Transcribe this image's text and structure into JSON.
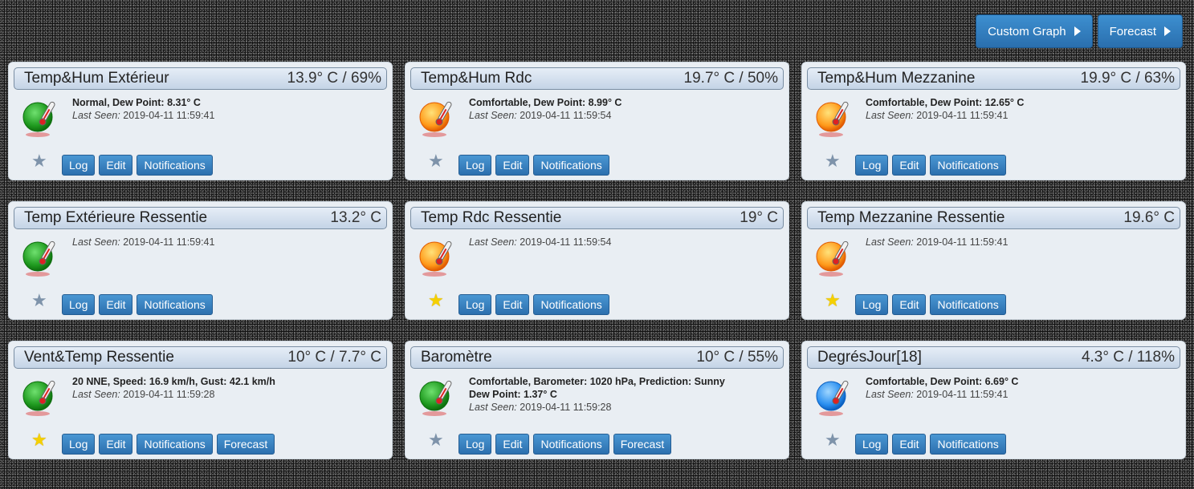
{
  "top_buttons": {
    "custom_graph": "Custom Graph",
    "forecast": "Forecast"
  },
  "labels": {
    "last_seen": "Last Seen:",
    "log": "Log",
    "edit": "Edit",
    "notifications": "Notifications",
    "forecast": "Forecast"
  },
  "colors": {
    "button": "#2c6fae",
    "card_bg": "#e9eef3",
    "header_bg": "#c4d4e6",
    "star_on": "#f5d000",
    "star_off": "#7e93aa"
  },
  "cards": [
    {
      "title": "Temp&Hum Extérieur",
      "value": "13.9° C / 69%",
      "icon": "green-temp-icon",
      "status": "Normal, Dew Point: 8.31° C",
      "extra": "",
      "last_seen": "2019-04-11 11:59:41",
      "favorite": false,
      "has_forecast": false
    },
    {
      "title": "Temp&Hum Rdc",
      "value": "19.7° C / 50%",
      "icon": "orange-temp-icon",
      "status": "Comfortable, Dew Point: 8.99° C",
      "extra": "",
      "last_seen": "2019-04-11 11:59:54",
      "favorite": false,
      "has_forecast": false
    },
    {
      "title": "Temp&Hum Mezzanine",
      "value": "19.9° C / 63%",
      "icon": "orange-temp-icon",
      "status": "Comfortable, Dew Point: 12.65° C",
      "extra": "",
      "last_seen": "2019-04-11 11:59:41",
      "favorite": false,
      "has_forecast": false
    },
    {
      "title": "Temp Extérieure Ressentie",
      "value": "13.2° C",
      "icon": "green-temp-icon",
      "status": "",
      "extra": "",
      "last_seen": "2019-04-11 11:59:41",
      "favorite": false,
      "has_forecast": false
    },
    {
      "title": "Temp Rdc Ressentie",
      "value": "19° C",
      "icon": "orange-temp-icon",
      "status": "",
      "extra": "",
      "last_seen": "2019-04-11 11:59:54",
      "favorite": true,
      "has_forecast": false
    },
    {
      "title": "Temp Mezzanine Ressentie",
      "value": "19.6° C",
      "icon": "orange-temp-icon",
      "status": "",
      "extra": "",
      "last_seen": "2019-04-11 11:59:41",
      "favorite": true,
      "has_forecast": false
    },
    {
      "title": "Vent&Temp Ressentie",
      "value": "10° C / 7.7° C",
      "icon": "green-temp-icon",
      "status": "20 NNE, Speed: 16.9 km/h, Gust: 42.1 km/h",
      "extra": "",
      "last_seen": "2019-04-11 11:59:28",
      "favorite": true,
      "has_forecast": true
    },
    {
      "title": "Baromètre",
      "value": "10° C / 55%",
      "icon": "green-temp-icon",
      "status": "Comfortable, Barometer: 1020 hPa, Prediction: Sunny",
      "extra": "Dew Point: 1.37° C",
      "last_seen": "2019-04-11 11:59:28",
      "favorite": false,
      "has_forecast": true
    },
    {
      "title": "DegrésJour[18]",
      "value": "4.3° C / 118%",
      "icon": "blue-temp-icon",
      "status": "Comfortable, Dew Point: 6.69° C",
      "extra": "",
      "last_seen": "2019-04-11 11:59:41",
      "favorite": false,
      "has_forecast": false
    }
  ]
}
